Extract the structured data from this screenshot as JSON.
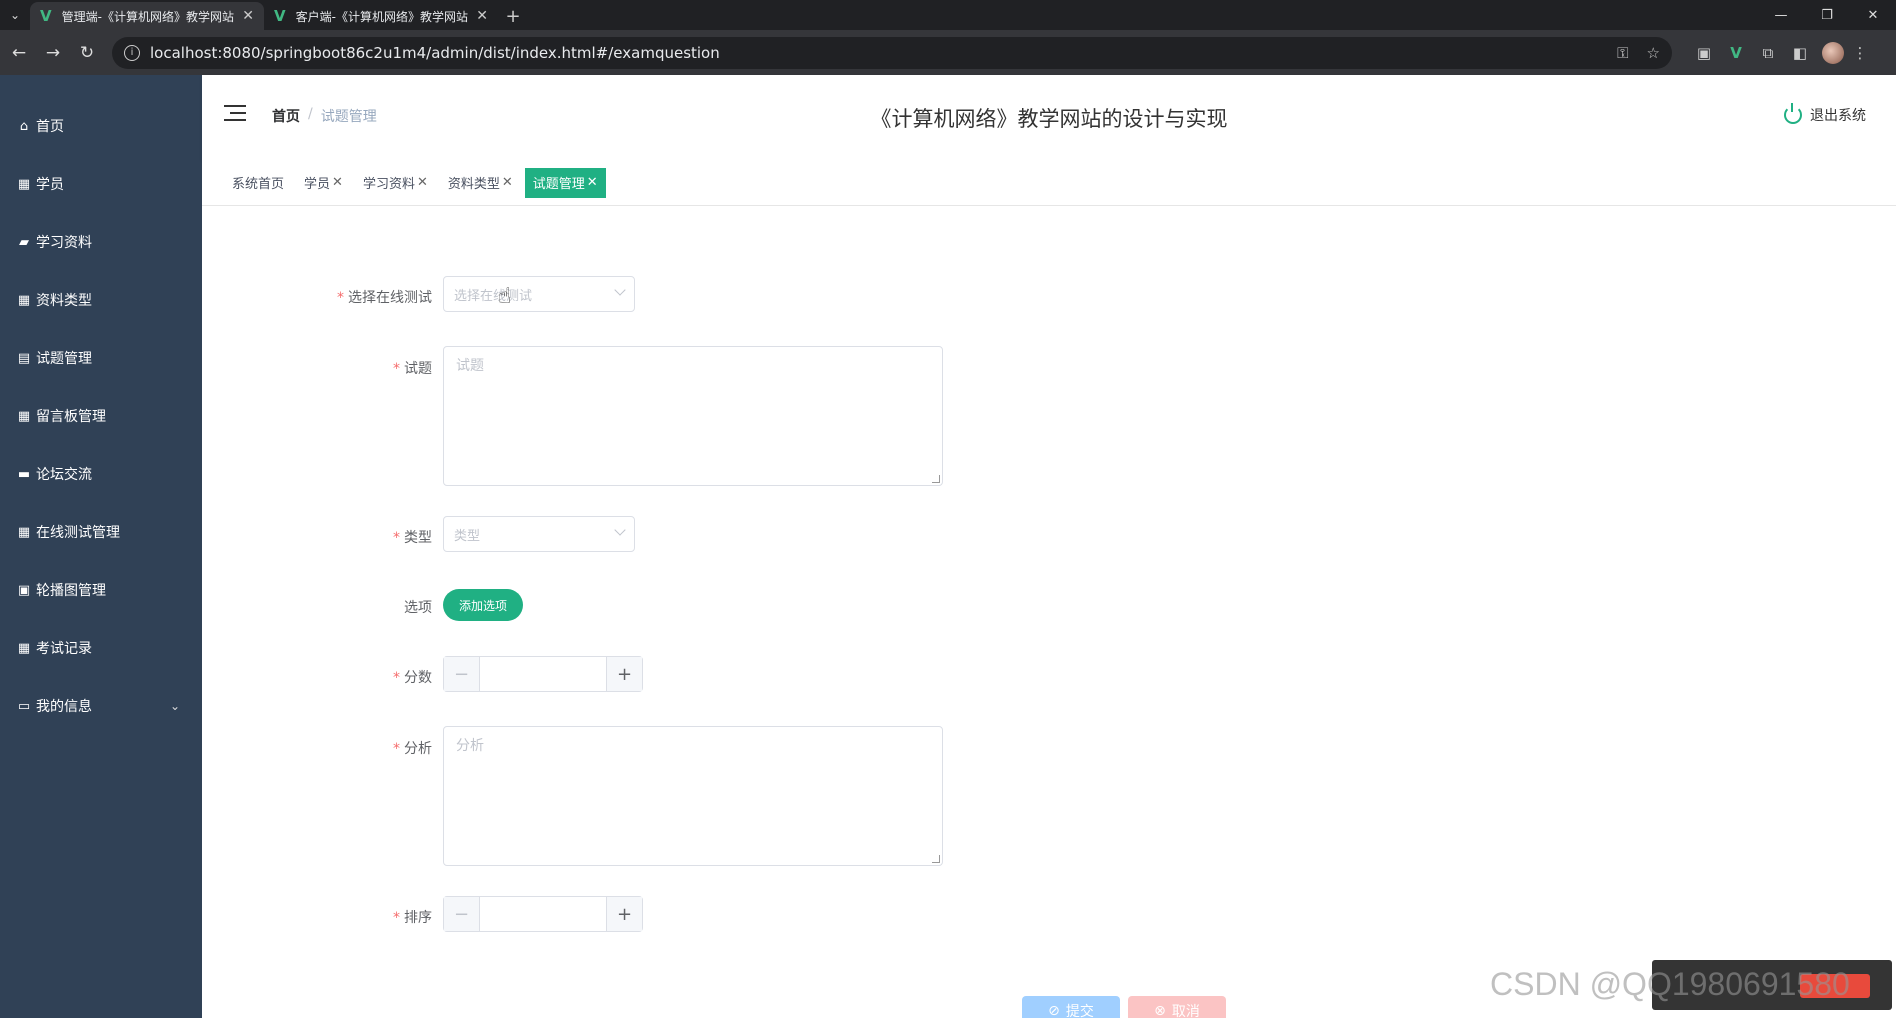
{
  "browser": {
    "tabs": [
      {
        "title": "管理端-《计算机网络》教学网站",
        "active": true
      },
      {
        "title": "客户端-《计算机网络》教学网站",
        "active": false
      }
    ],
    "url": "localhost:8080/springboot86c2u1m4/admin/dist/index.html#/examquestion"
  },
  "sidebar": {
    "items": [
      {
        "label": "首页",
        "icon": "home-icon"
      },
      {
        "label": "学员",
        "icon": "grid-icon"
      },
      {
        "label": "学习资料",
        "icon": "folder-icon"
      },
      {
        "label": "资料类型",
        "icon": "grid-icon"
      },
      {
        "label": "试题管理",
        "icon": "clipboard-icon"
      },
      {
        "label": "留言板管理",
        "icon": "grid-icon"
      },
      {
        "label": "论坛交流",
        "icon": "monitor-icon"
      },
      {
        "label": "在线测试管理",
        "icon": "grid-icon"
      },
      {
        "label": "轮播图管理",
        "icon": "image-icon"
      },
      {
        "label": "考试记录",
        "icon": "grid-icon"
      },
      {
        "label": "我的信息",
        "icon": "card-icon"
      }
    ]
  },
  "header": {
    "breadcrumb_home": "首页",
    "breadcrumb_separator": "/",
    "breadcrumb_current": "试题管理",
    "title": "《计算机网络》教学网站的设计与实现",
    "logout": "退出系统"
  },
  "tagsview": {
    "tags": [
      "系统首页",
      "学员",
      "学习资料",
      "资料类型",
      "试题管理"
    ],
    "close_glyph": "✕"
  },
  "form": {
    "required_mark": "*",
    "test_label": "选择在线测试",
    "test_placeholder": "选择在线测试",
    "question_label": "试题",
    "question_placeholder": "试题",
    "type_label": "类型",
    "type_placeholder": "类型",
    "options_label": "选项",
    "add_option": "添加选项",
    "score_label": "分数",
    "analysis_label": "分析",
    "analysis_placeholder": "分析",
    "order_label": "排序",
    "submit": "提交",
    "cancel": "取消",
    "minus": "−",
    "plus": "+"
  },
  "watermark": "CSDN @QQ1980691580"
}
